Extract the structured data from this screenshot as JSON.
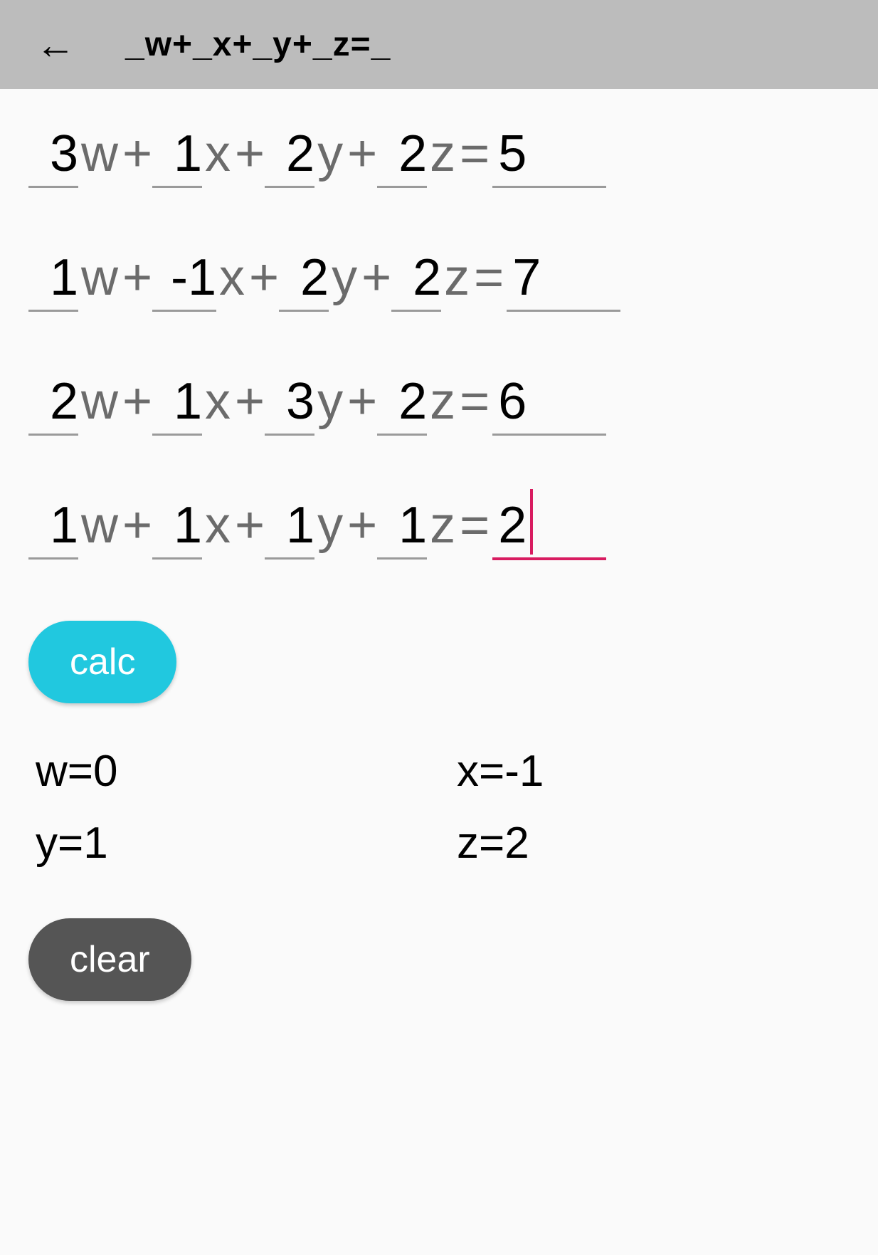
{
  "header": {
    "title": "_w+_x+_y+_z=_"
  },
  "vars": [
    "w",
    "x",
    "y",
    "z"
  ],
  "equations": [
    {
      "coefs": [
        "3",
        "1",
        "2",
        "2"
      ],
      "rhs": "5"
    },
    {
      "coefs": [
        "1",
        "-1",
        "2",
        "2"
      ],
      "rhs": "7"
    },
    {
      "coefs": [
        "2",
        "1",
        "3",
        "2"
      ],
      "rhs": "6"
    },
    {
      "coefs": [
        "1",
        "1",
        "1",
        "1"
      ],
      "rhs": "2",
      "active": true
    }
  ],
  "buttons": {
    "calc": "calc",
    "clear": "clear"
  },
  "results": {
    "w": "w=0",
    "x": "x=-1",
    "y": "y=1",
    "z": "z=2"
  }
}
